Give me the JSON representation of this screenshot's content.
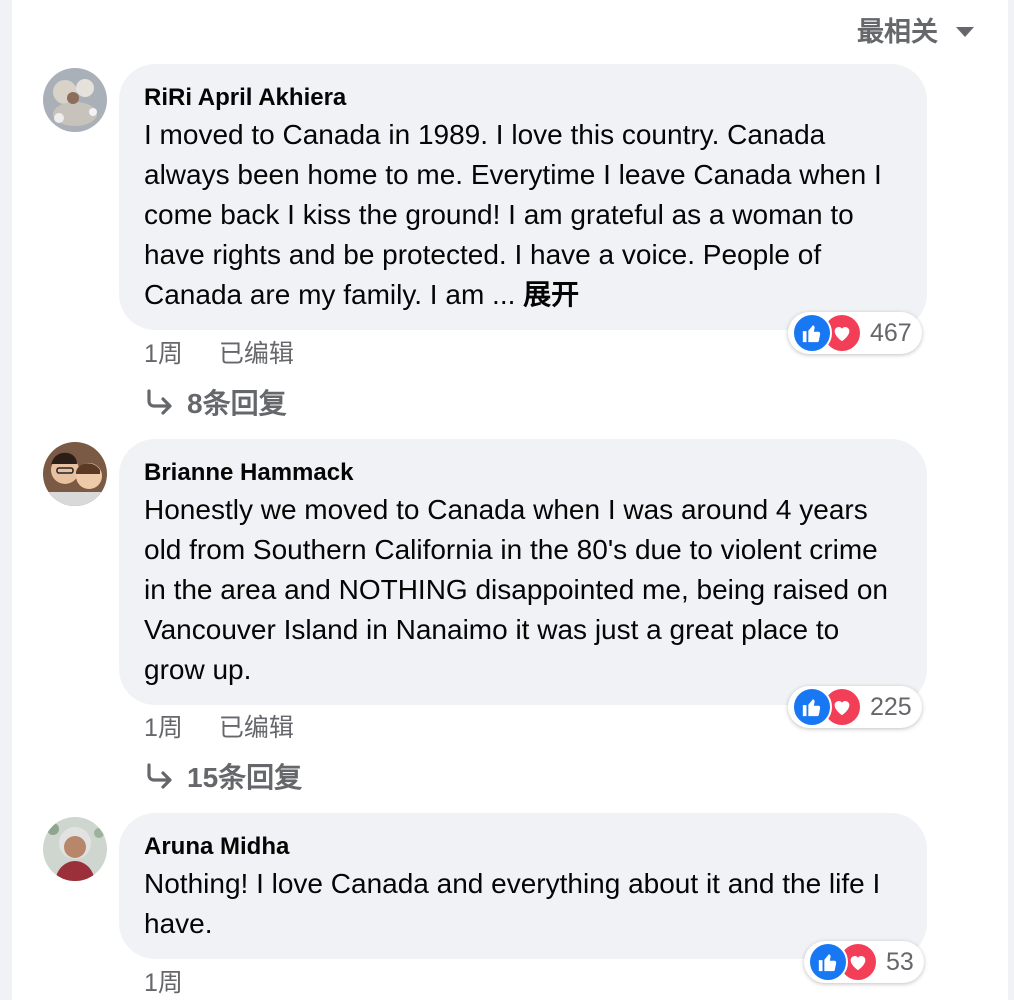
{
  "sort": {
    "label": "最相关"
  },
  "colors": {
    "bubble": "#f0f2f5",
    "meta_text": "#65676b",
    "like_blue": "#1877f2",
    "love_red": "#f33e58"
  },
  "comments": [
    {
      "author": "RiRi April Akhiera",
      "text": "I moved to Canada in 1989. I love this country. Canada always been home to me. Everytime I leave Canada when I come back I kiss the ground! I am grateful as a woman to have rights and be protected. I have a voice. People of Canada are my family. I am ...",
      "see_more": "展开",
      "time": "1周",
      "edited": "已编辑",
      "reaction_count": "467",
      "replies": "8条回复"
    },
    {
      "author": "Brianne Hammack",
      "text": "Honestly we moved to Canada when I was around 4 years old from Southern California in the 80's due to violent crime in the area and NOTHING disappointed me, being raised on Vancouver Island in Nanaimo it was just a great place to grow up.",
      "time": "1周",
      "edited": "已编辑",
      "reaction_count": "225",
      "replies": "15条回复"
    },
    {
      "author": "Aruna Midha",
      "text": "Nothing! I love Canada and everything about it and the life I have.",
      "time": "1周",
      "reaction_count": "53"
    }
  ]
}
